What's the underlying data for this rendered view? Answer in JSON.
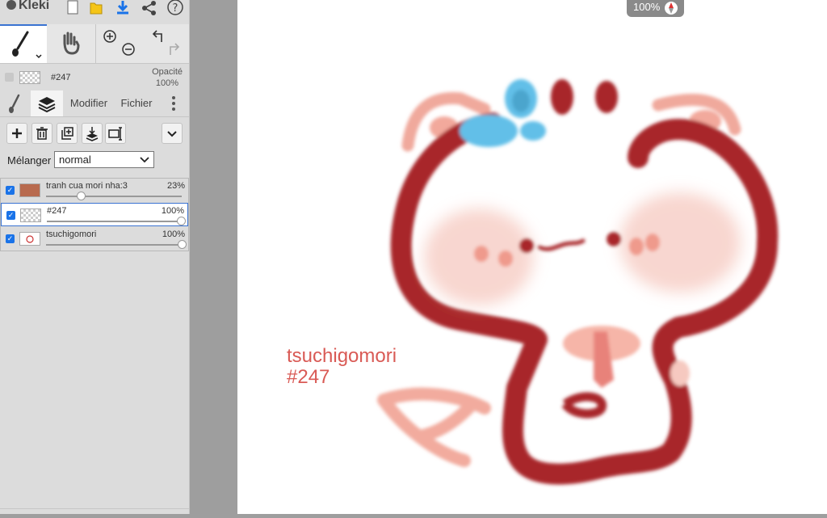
{
  "app": {
    "name": "Kleki"
  },
  "top_icons": [
    "new-file-icon",
    "open-folder-icon",
    "download-icon",
    "share-icon",
    "help-icon"
  ],
  "tools": [
    "brush-tool-icon",
    "hand-tool-icon",
    "zoom-in-icon",
    "zoom-out-icon",
    "undo-icon",
    "redo-icon"
  ],
  "layer_info": {
    "name": "#247",
    "opacity_label": "Opacité",
    "opacity_value": "100%"
  },
  "tabs": {
    "modify": "Modifier",
    "file": "Fichier"
  },
  "blend": {
    "label": "Mélanger",
    "value": "normal"
  },
  "layers": [
    {
      "name": "tranh cua mori nha:3",
      "opacity": "23%",
      "opacity_value": 23
    },
    {
      "name": "#247",
      "opacity": "100%",
      "opacity_value": 100
    },
    {
      "name": "tsuchigomori",
      "opacity": "100%",
      "opacity_value": 100
    }
  ],
  "canvas": {
    "zoom": "100%",
    "caption_line1": "tsuchigomori",
    "caption_line2": "#247",
    "colors": {
      "dark_red": "#a8282a",
      "pink": "#f2a79a",
      "blush": "#f6c9c0",
      "blue": "#62bfe8",
      "text": "#d95a55"
    }
  }
}
